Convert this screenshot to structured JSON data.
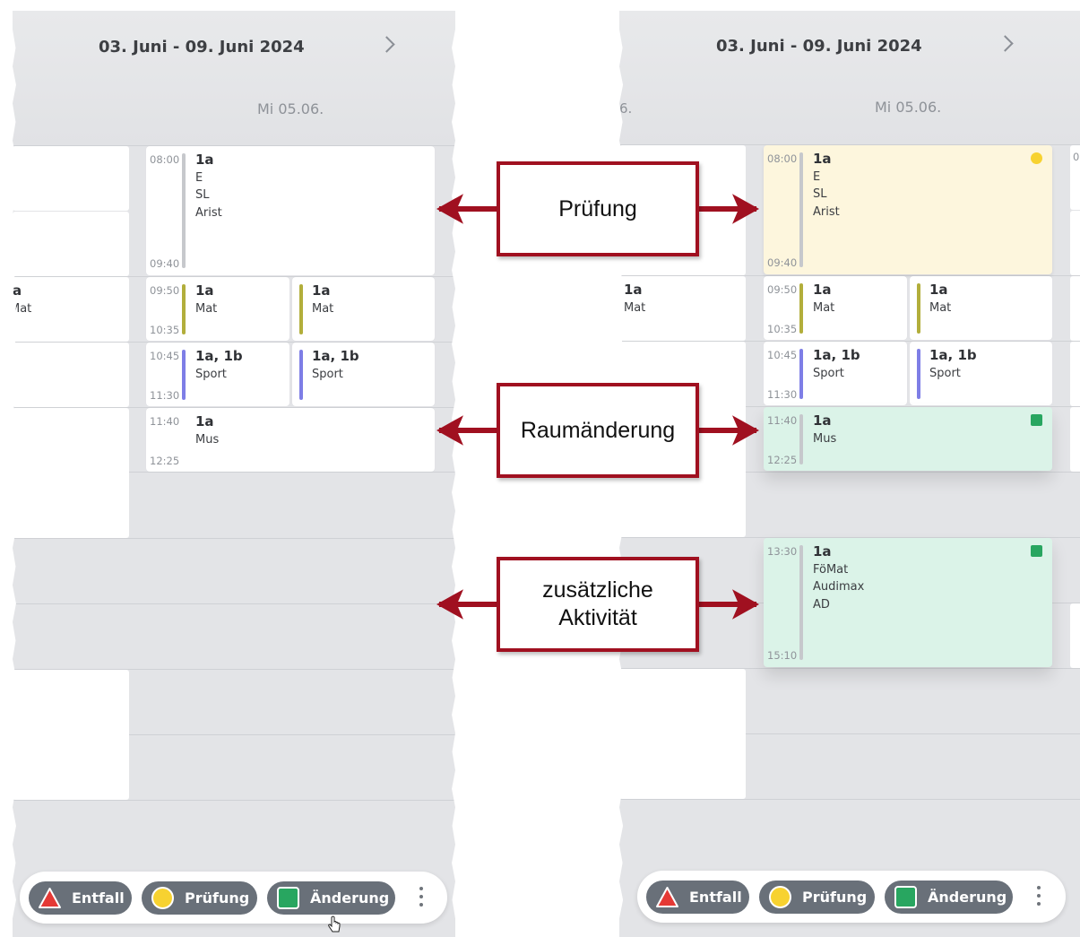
{
  "header": {
    "date_range": "03. Juni - 09. Juni 2024",
    "day_label": "Mi 05.06.",
    "left_day_fragment": "6."
  },
  "left_fragments": {
    "cls": "a",
    "subj": "Mat"
  },
  "right_edge_fragment": "0",
  "lessons": [
    {
      "time_start": "08:00",
      "time_end": "09:40",
      "class": "1a",
      "lines": [
        "E",
        "SL",
        "Arist"
      ],
      "bar_color": "#c6c8cc",
      "status": "Prüfung"
    },
    {
      "time_start": "09:50",
      "time_end": "10:35",
      "class": "1a",
      "lines": [
        "Mat"
      ],
      "bar_color": "#b2ae3b"
    },
    {
      "class": "1a",
      "lines": [
        "Mat"
      ],
      "bar_color": "#b2ae3b"
    },
    {
      "time_start": "10:45",
      "time_end": "11:30",
      "class": "1a, 1b",
      "lines": [
        "Sport"
      ],
      "bar_color": "#7e7ee6"
    },
    {
      "class": "1a, 1b",
      "lines": [
        "Sport"
      ],
      "bar_color": "#7e7ee6"
    },
    {
      "time_start": "11:40",
      "time_end": "12:25",
      "class": "1a",
      "lines": [
        "Mus"
      ],
      "bar_color": "#c6c8cc",
      "status": "Änderung"
    },
    {
      "time_start": "13:30",
      "time_end": "15:10",
      "class": "1a",
      "lines": [
        "FöMat",
        "Audimax",
        "AD"
      ],
      "bar_color": "#c6c8cc",
      "status": "Änderung"
    }
  ],
  "legend": [
    {
      "label": "Entfall",
      "icon": "red-triangle-icon",
      "color": "#e53935"
    },
    {
      "label": "Prüfung",
      "icon": "yellow-circle-icon",
      "color": "#f7d230"
    },
    {
      "label": "Änderung",
      "icon": "green-square-icon",
      "color": "#28a660"
    }
  ],
  "callouts": {
    "exam": "Prüfung",
    "room_change": "Raumänderung",
    "extra_line1": "zusätzliche",
    "extra_line2": "Aktivität"
  },
  "colors": {
    "callout_border": "#a01020",
    "exam_bg": "#fdf6dd",
    "change_bg": "#dbf3e8",
    "chip_bg": "#697079"
  }
}
